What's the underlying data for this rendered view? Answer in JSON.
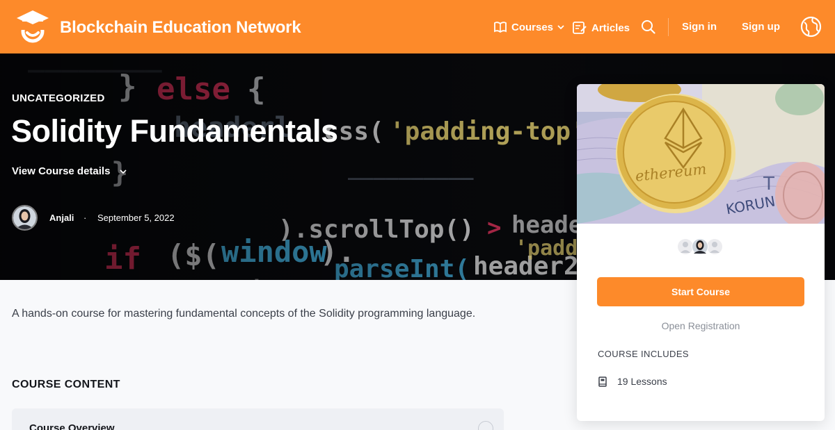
{
  "header": {
    "brand": "Blockchain Education Network",
    "nav": {
      "courses": "Courses",
      "articles": "Articles",
      "sign_in": "Sign in",
      "sign_up": "Sign up"
    }
  },
  "hero": {
    "category": "UNCATEGORIZED",
    "title": "Solidity Fundamentals",
    "details_link": "View Course details",
    "author": "Anjali",
    "separator": "·",
    "date": "September 5, 2022"
  },
  "main": {
    "description": "A hands-on course for mastering fundamental concepts of the Solidity programming language.",
    "content_heading": "COURSE CONTENT",
    "lessons": [
      {
        "title": "Course Overview"
      }
    ]
  },
  "sidebar": {
    "coin_text": "ethereum",
    "note_text": "KORUN",
    "start_button": "Start Course",
    "registration": "Open Registration",
    "includes_heading": "COURSE INCLUDES",
    "includes_item": "19 Lessons"
  },
  "colors": {
    "accent": "#fd8a2a",
    "text_dark": "#14161b",
    "text_body": "#3a3f49",
    "muted": "#8a8f98"
  },
  "icons": {
    "logo": "graduation-cap-smile-icon",
    "courses": "book-icon",
    "articles": "article-edit-icon",
    "search": "search-icon",
    "language": "globe-icon",
    "details": "chevron-down-icon",
    "lessons": "book-icon"
  }
}
